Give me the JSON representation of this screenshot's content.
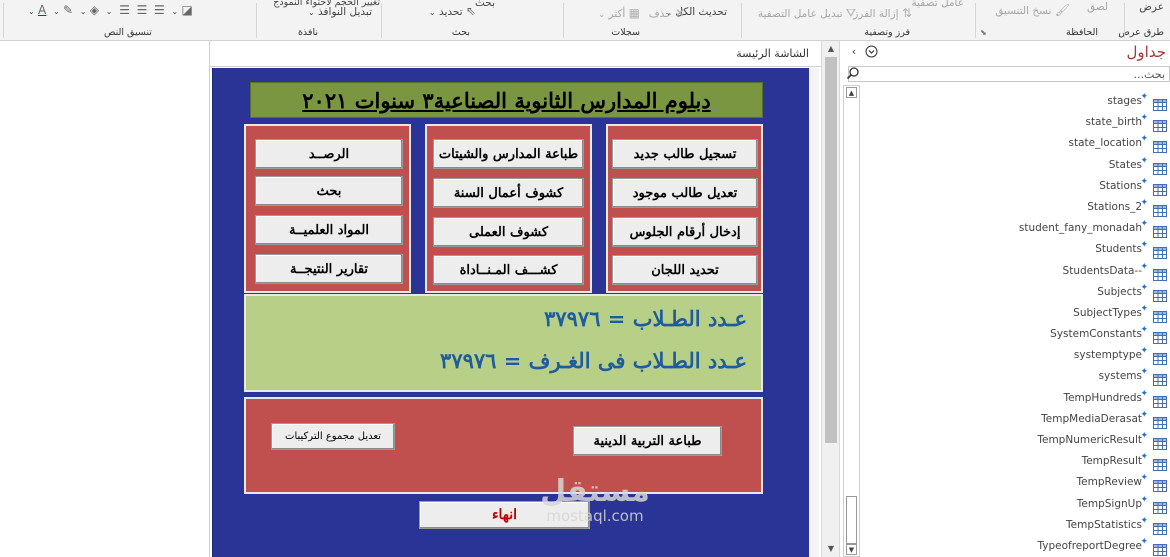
{
  "ribbon": {
    "groups": {
      "view": "طرق عرض",
      "clipboard": "الحافظة",
      "sort_filter": "فرز وتصفية",
      "records": "سجلات",
      "find": "بحث",
      "window": "نافذة",
      "text_format": "تنسيق النص"
    },
    "items": {
      "view_btn": "عرض",
      "paste": "لصق",
      "format_painter": "نسخ التنسيق",
      "filter": "عامل تصفية",
      "remove_sort": "إزالة الفرز",
      "toggle_filter": "تبديل عامل التصفية",
      "refresh_all": "تحديث الكل",
      "delete": "حذف",
      "more": "أكثر",
      "find": "بحث",
      "select": "تحديد",
      "size_to_fit": "تغيير الحجم لاحتواء النموذج",
      "switch_windows": "تبديل النوافذ"
    }
  },
  "form": {
    "tab_title": "الشاشة الرئيسة",
    "title": "دبلوم المدارس الثانوية الصناعية٣ سنوات ٢٠٢١",
    "column_right": [
      "تسجيل طالب جديد",
      "تعديل طالب موجود",
      "إدخال أرقام الجلوس",
      "تحديد اللجان"
    ],
    "column_middle": [
      "طباعة المدارس والشيتات",
      "كشوف أعمال السنة",
      "كشوف العملى",
      "كشـــف المـنــاداة"
    ],
    "column_left": [
      "الرصــد",
      "بحث",
      "المواد العلميــة",
      "تقارير النتيجــة"
    ],
    "stat_students": "عـدد الطـلاب = ٣٧٩٧٦",
    "stat_rooms": "عـدد الطـلاب فى الغـرف  =  ٣٧٩٧٦",
    "btn_religion": "طباعة التربية الدينية",
    "btn_edit_compositions": "تعديل مجموع التركيبات",
    "btn_exit": "انهاء"
  },
  "watermark": {
    "main": "مستقل",
    "sub": "mostaql.com"
  },
  "nav": {
    "title": "جداول",
    "search_placeholder": "بحث...",
    "tables": [
      "stages",
      "state_birth",
      "state_location",
      "States",
      "Stations",
      "Stations_2",
      "student_fany_monadah",
      "Students",
      "StudentsData--",
      "Subjects",
      "SubjectTypes",
      "SystemConstants",
      "systemptype",
      "systems",
      "TempHundreds",
      "TempMediaDerasat",
      "TempNumericResult",
      "TempResult",
      "TempReview",
      "TempSignUp",
      "TempStatistics",
      "TypeofreportDegree"
    ]
  },
  "colors": {
    "form_background": "#2a3496",
    "title_banner": "#7a9640",
    "panel_red": "#c0504d",
    "panel_green": "#b8cf88",
    "stat_text": "#1f5c9c",
    "exit_text": "#c00000",
    "nav_title": "#a4373a"
  }
}
